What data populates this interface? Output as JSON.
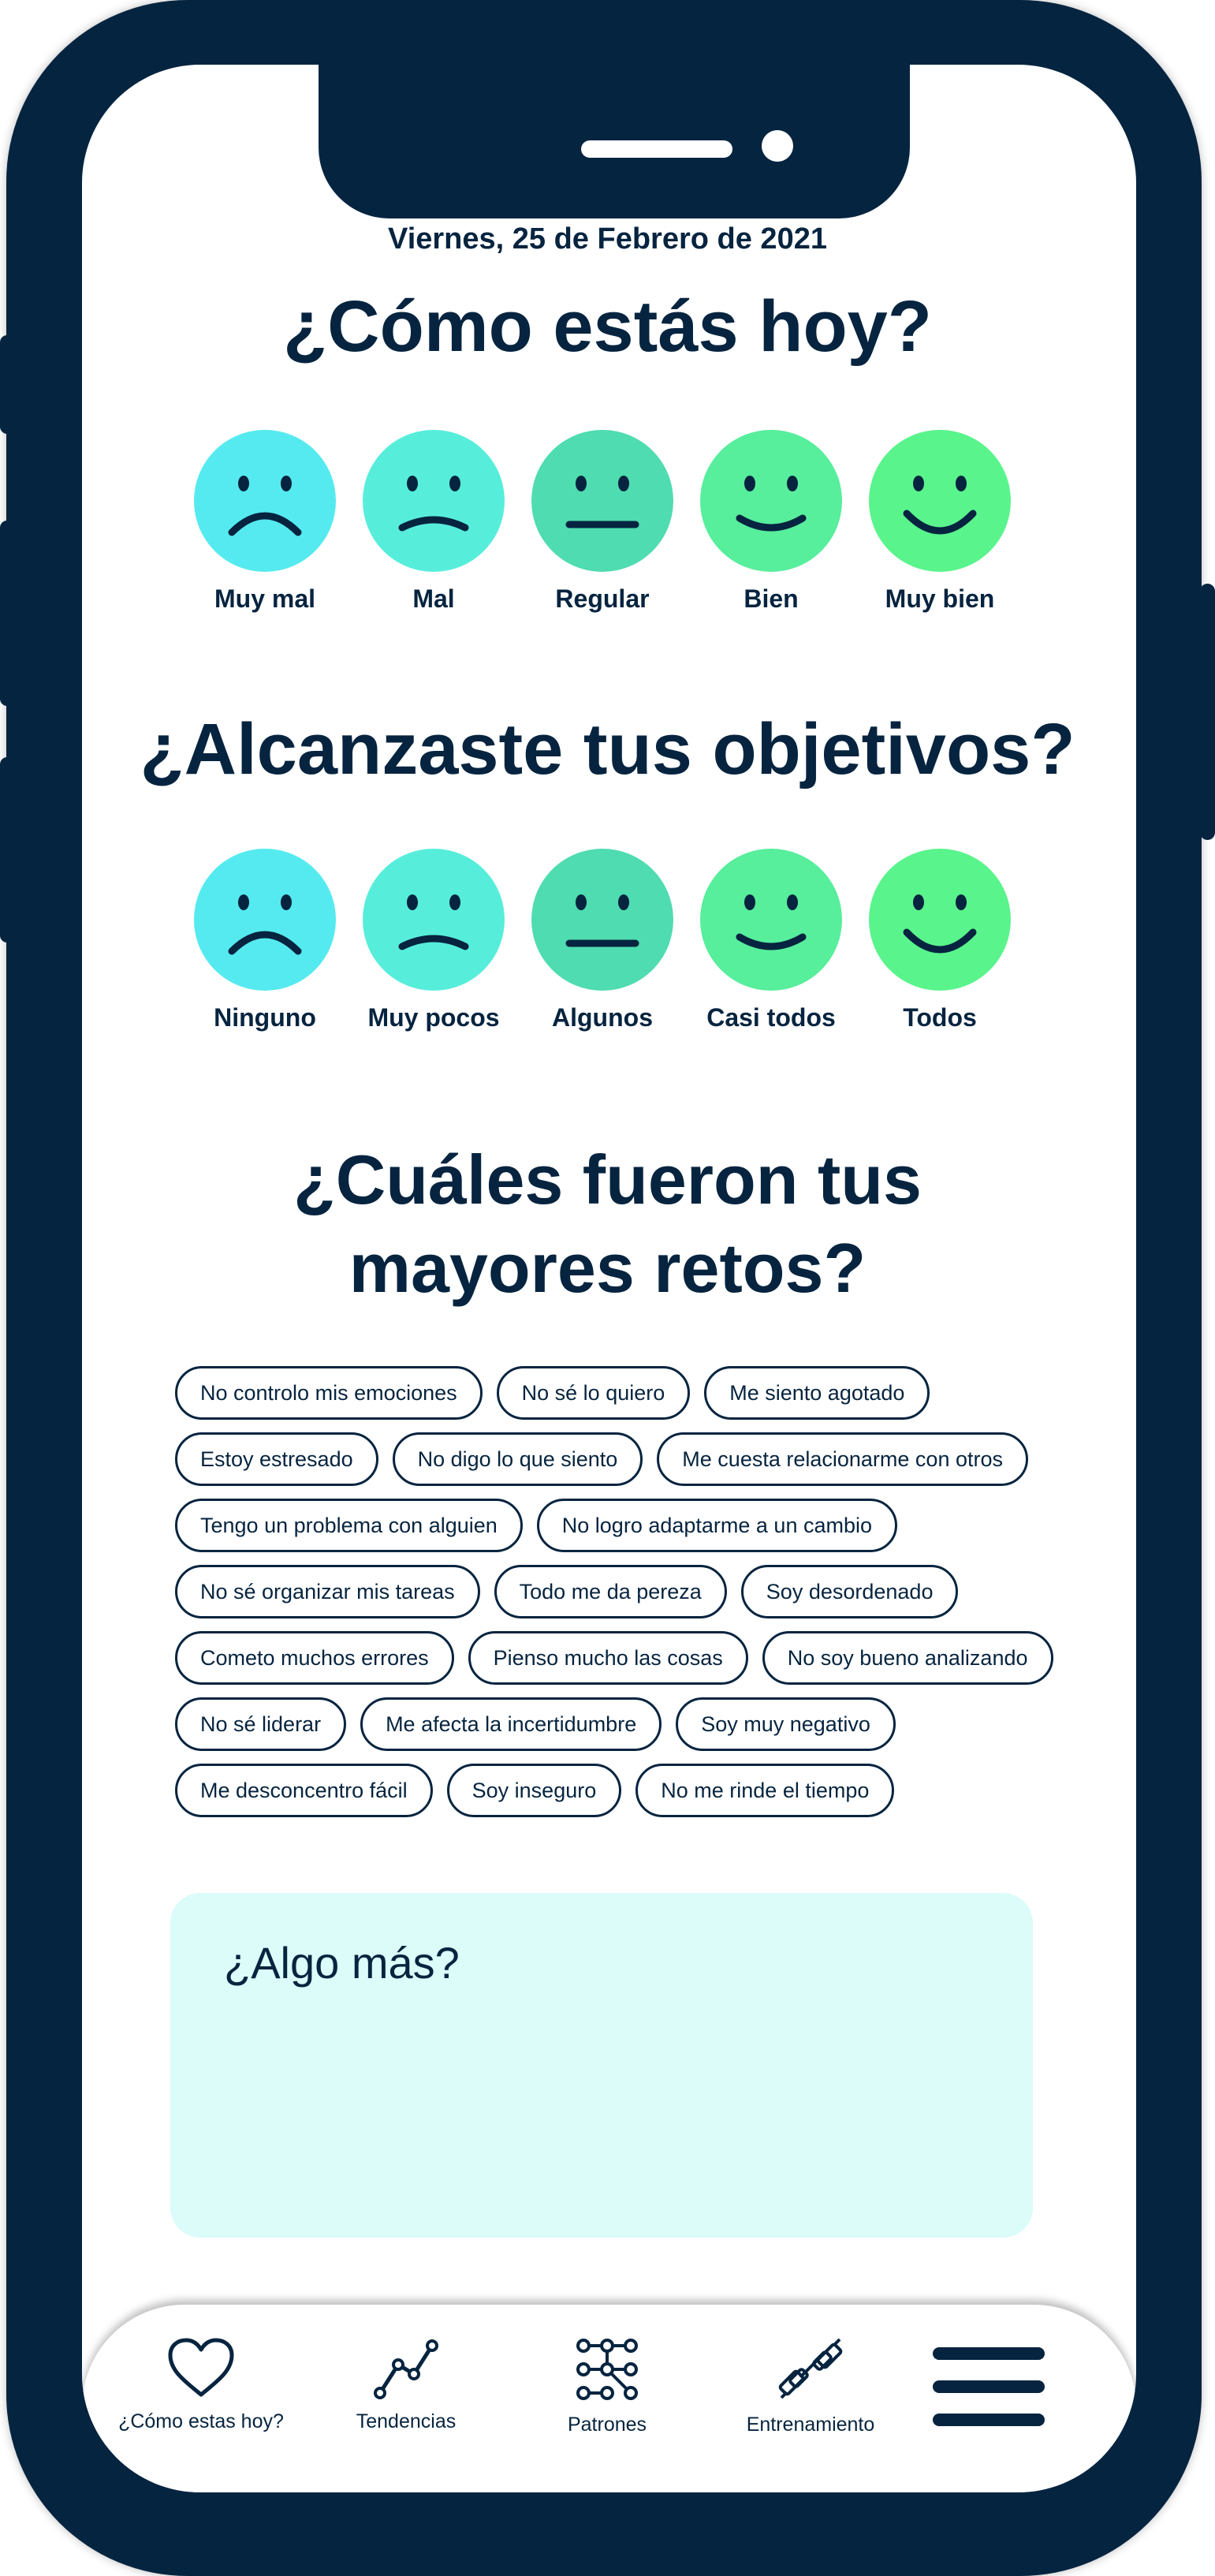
{
  "date": "Viernes, 25 de Febrero de 2021",
  "question_mood": "¿Cómo estás hoy?",
  "question_goals": "¿Alcanzaste tus objetivos?",
  "question_challenges_line1": "¿Cuáles fueron tus",
  "question_challenges_line2": "mayores retos?",
  "mood_options": [
    "Muy mal",
    "Mal",
    "Regular",
    "Bien",
    "Muy bien"
  ],
  "goal_options": [
    "Ninguno",
    "Muy pocos",
    "Algunos",
    "Casi todos",
    "Todos"
  ],
  "face_colors": [
    "#55eaef",
    "#56eedb",
    "#4fdcb0",
    "#57ee9c",
    "#59f48c"
  ],
  "challenges": [
    [
      "No controlo mis emociones",
      "No sé lo quiero",
      "Me siento agotado"
    ],
    [
      "Estoy estresado",
      "No digo lo que siento",
      "Me cuesta relacionarme con otros"
    ],
    [
      "Tengo un problema con alguien",
      "No logro adaptarme a un cambio"
    ],
    [
      "No sé organizar mis tareas",
      "Todo me da pereza",
      "Soy desordenado"
    ],
    [
      "Cometo muchos errores",
      "Pienso mucho las cosas",
      "No soy bueno analizando"
    ],
    [
      "No sé liderar",
      "Me afecta la incertidumbre",
      "Soy muy negativo"
    ],
    [
      "Me desconcentro fácil",
      "Soy inseguro",
      "No me rinde el tiempo"
    ]
  ],
  "more_placeholder": "¿Algo más?",
  "nav": {
    "mood": "¿Cómo estas hoy?",
    "trends": "Tendencias",
    "patterns": "Patrones",
    "training": "Entrenamiento"
  },
  "icons": [
    "heart-icon",
    "trend-line-icon",
    "pattern-nodes-icon",
    "dumbbell-icon",
    "hamburger-menu-icon"
  ]
}
